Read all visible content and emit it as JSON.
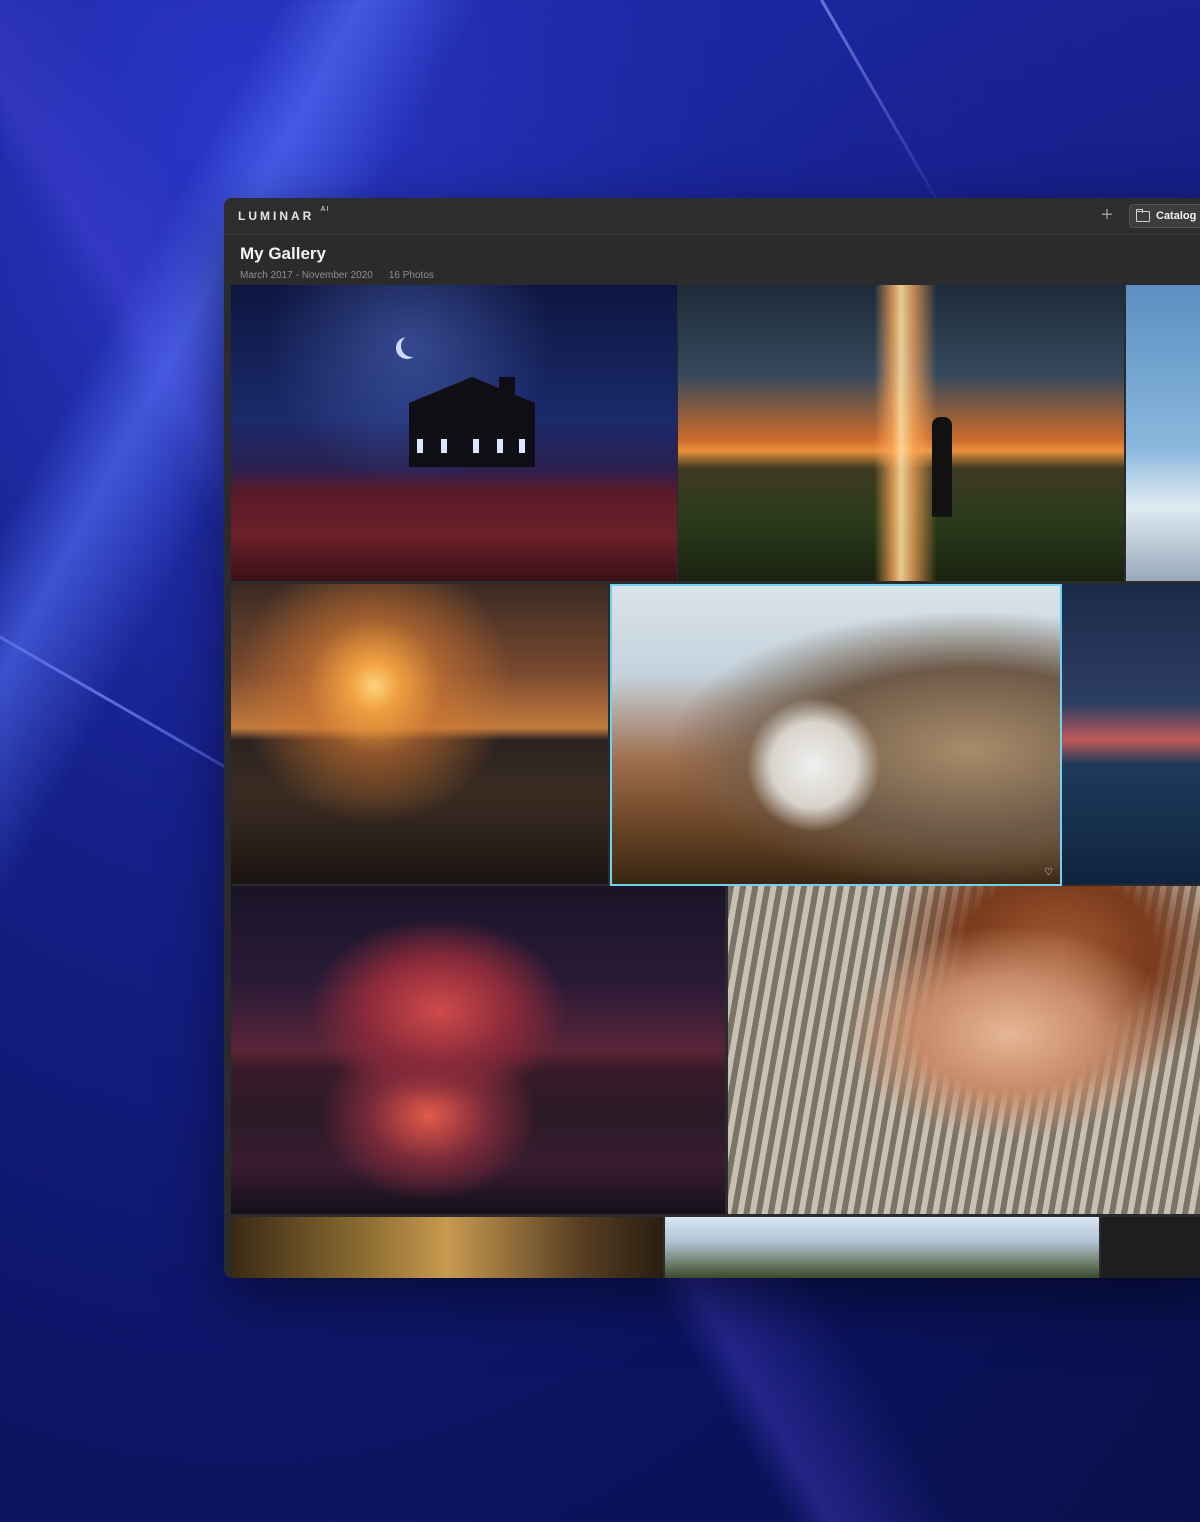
{
  "app": {
    "logo_text": "LUMINAR",
    "logo_suffix": "AI"
  },
  "toolbar": {
    "add_label": "+",
    "catalog_label": "Catalog"
  },
  "gallery": {
    "title": "My Gallery",
    "date_range": "March 2017 - November 2020",
    "photo_count": "16 Photos"
  },
  "colors": {
    "selection_border": "#6fd3f0",
    "window_bg": "#2b2b2d"
  },
  "photos": [
    {
      "id": "church-night",
      "selected": false
    },
    {
      "id": "waterfall-sunset",
      "selected": false
    },
    {
      "id": "mountain-tree",
      "selected": false
    },
    {
      "id": "pier-sunset",
      "selected": false
    },
    {
      "id": "dog-portrait",
      "selected": true,
      "favorite": true
    },
    {
      "id": "ocean-dusk",
      "selected": false
    },
    {
      "id": "red-mountain-reflection",
      "selected": false
    },
    {
      "id": "man-portrait",
      "selected": false
    },
    {
      "id": "bar-interior",
      "selected": false
    },
    {
      "id": "alps-landscape",
      "selected": false
    }
  ]
}
